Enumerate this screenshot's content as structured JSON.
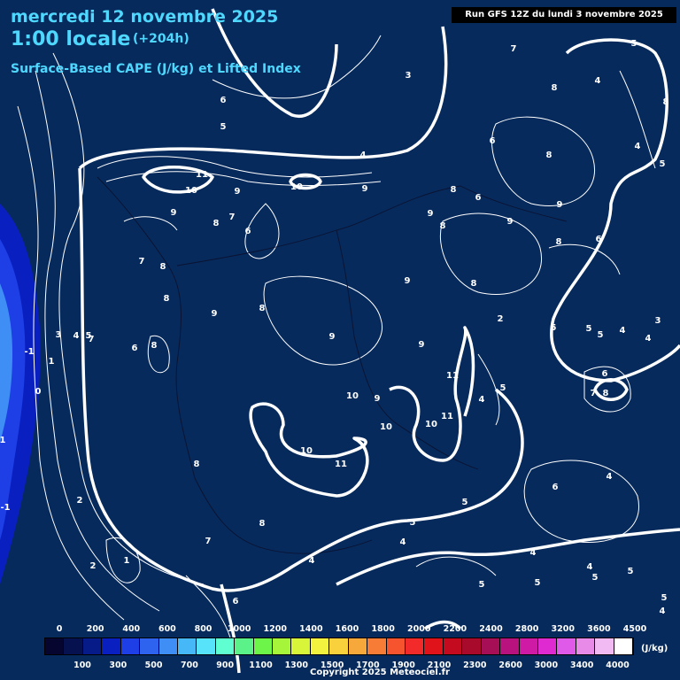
{
  "header": {
    "date": "mercredi 12 novembre 2025",
    "hour": "1:00 locale",
    "offset": "(+204h)",
    "product": "Surface-Based CAPE (J/kg) et Lifted Index",
    "run": "Run GFS 12Z du lundi 3 novembre 2025"
  },
  "legend": {
    "unit": "(J/kg)",
    "colors": [
      "#050530",
      "#06124f",
      "#061b87",
      "#0a1fbf",
      "#1e3fe6",
      "#2e63f0",
      "#3f8ef5",
      "#46b8f8",
      "#57e3fa",
      "#5fffd2",
      "#5cf28a",
      "#6ef54a",
      "#a6f53a",
      "#d8f53a",
      "#f3f23f",
      "#f8d13d",
      "#f7a83a",
      "#f77c35",
      "#f5542f",
      "#f22a2a",
      "#e0121a",
      "#c40a1e",
      "#a70a2a",
      "#a60f55",
      "#b8127e",
      "#cf1aa5",
      "#de2ad0",
      "#e05aea",
      "#e88ae8",
      "#f2baf2",
      "#ffffff"
    ],
    "top_ticks": [
      "0",
      "200",
      "400",
      "600",
      "800",
      "1000",
      "1200",
      "1400",
      "1600",
      "1800",
      "2000",
      "2200",
      "2400",
      "2800",
      "3200",
      "3600",
      "4500"
    ],
    "bottom_ticks": [
      "100",
      "300",
      "500",
      "700",
      "900",
      "1100",
      "1300",
      "1500",
      "1700",
      "1900",
      "2100",
      "2300",
      "2600",
      "3000",
      "3400",
      "4000"
    ]
  },
  "map_labels": [
    "3",
    "7",
    "5",
    "6",
    "5",
    "8",
    "4",
    "8",
    "4",
    "6",
    "8",
    "4",
    "5",
    "11",
    "10",
    "9",
    "10",
    "9",
    "8",
    "6",
    "9",
    "9",
    "9",
    "8",
    "8",
    "6",
    "6",
    "9",
    "8",
    "7",
    "8",
    "7",
    "8",
    "9",
    "8",
    "9",
    "8",
    "9",
    "10",
    "2",
    "3",
    "4",
    "5",
    "7",
    "6",
    "8",
    "9",
    "9",
    "11",
    "5",
    "4",
    "11",
    "10",
    "10",
    "10",
    "11",
    "6",
    "7",
    "8",
    "5",
    "5",
    "5",
    "4",
    "-1",
    "1",
    "0",
    "1",
    "-1",
    "2",
    "2",
    "1",
    "8",
    "8",
    "7",
    "4",
    "6",
    "5",
    "4",
    "6",
    "5",
    "4",
    "5",
    "4",
    "5",
    "3",
    "4",
    "4",
    "5",
    "5",
    "4",
    "5"
  ],
  "copyright": "Copyright 2025 Meteociel.fr"
}
